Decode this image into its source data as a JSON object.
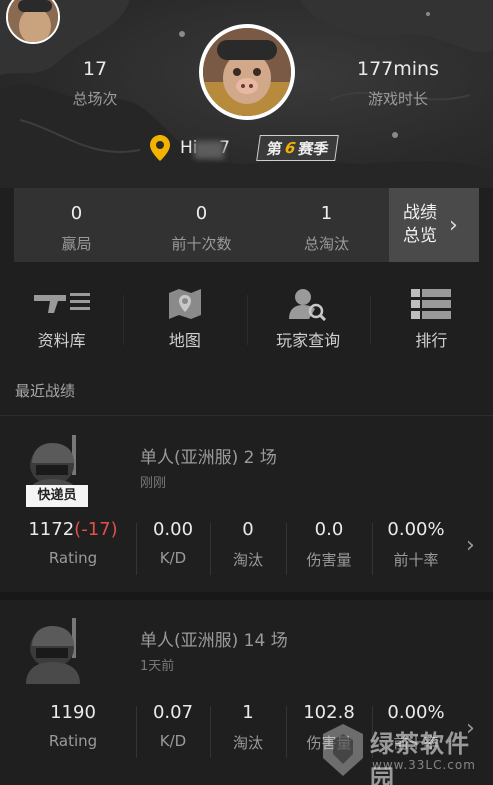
{
  "header": {
    "total_matches": "17",
    "total_matches_label": "总场次",
    "play_time": "177mins",
    "play_time_label": "游戏时长",
    "username": "Hi··· 7",
    "season_prefix": "第",
    "season_number": "6",
    "season_suffix": "赛季"
  },
  "summary": {
    "wins": "0",
    "wins_label": "赢局",
    "top10": "0",
    "top10_label": "前十次数",
    "kills": "1",
    "kills_label": "总淘汰",
    "overview_line1": "战绩",
    "overview_line2": "总览"
  },
  "tools": [
    {
      "label": "资料库",
      "icon": "gun-database-icon"
    },
    {
      "label": "地图",
      "icon": "map-icon"
    },
    {
      "label": "玩家查询",
      "icon": "player-search-icon"
    },
    {
      "label": "排行",
      "icon": "ranking-icon"
    }
  ],
  "recent_title": "最近战绩",
  "matches": [
    {
      "title": "单人(亚洲服) 2 场",
      "time": "刚刚",
      "badge": "快递员",
      "rating": "1172",
      "rating_change": "(-17)",
      "kd": "0.00",
      "kills": "0",
      "damage": "0.0",
      "top10_rate": "0.00%"
    },
    {
      "title": "单人(亚洲服) 14 场",
      "time": "1天前",
      "rating": "1190",
      "kd": "0.07",
      "kills": "1",
      "damage": "102.8",
      "top10_rate": "0.00%"
    }
  ],
  "stat_labels": {
    "rating": "Rating",
    "kd": "K/D",
    "kills": "淘汰",
    "damage": "伤害量",
    "top10": "前十率"
  },
  "watermark": {
    "name": "绿茶软件园",
    "url": "www.33LC.com"
  },
  "colors": {
    "background": "#1f1f1f",
    "accent_gold": "#f2b200",
    "negative": "#e0504a"
  }
}
